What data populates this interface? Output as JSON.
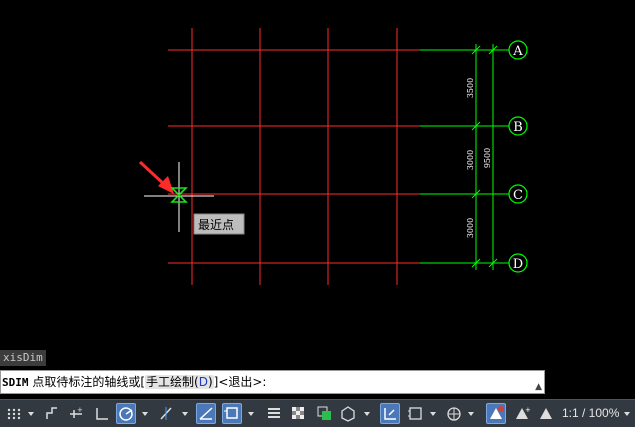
{
  "drawing": {
    "axis_labels": [
      "A",
      "B",
      "C",
      "D"
    ],
    "dimensions": [
      "3500",
      "3000",
      "3000",
      "9500"
    ],
    "snap_tooltip": "最近点",
    "colors": {
      "grid": "#ff2a2a",
      "axis": "#00ff00",
      "text": "#ffffff",
      "background": "#000000"
    }
  },
  "command": {
    "history": "xisDim",
    "prompt_name": "SDIM",
    "prompt_text": "点取待标注的轴线或[",
    "option_label": "手工绘制(",
    "option_key": "D",
    "option_close": ")",
    "prompt_tail": "]<退出>:"
  },
  "statusbar": {
    "zoom": "1:1 / 100%",
    "icons": [
      "grid-icon",
      "snap-icon",
      "infer-icon",
      "ortho-icon",
      "polar-icon",
      "osnap-track-icon",
      "isoplane-icon",
      "dynamic-ucs-icon",
      "lineweight-icon",
      "transparency-icon",
      "selection-cycling-icon",
      "3d-osnap-icon",
      "annotation-monitor-icon",
      "units-icon",
      "quick-props-icon",
      "annotation-scale-icon",
      "workspace-icon"
    ]
  }
}
